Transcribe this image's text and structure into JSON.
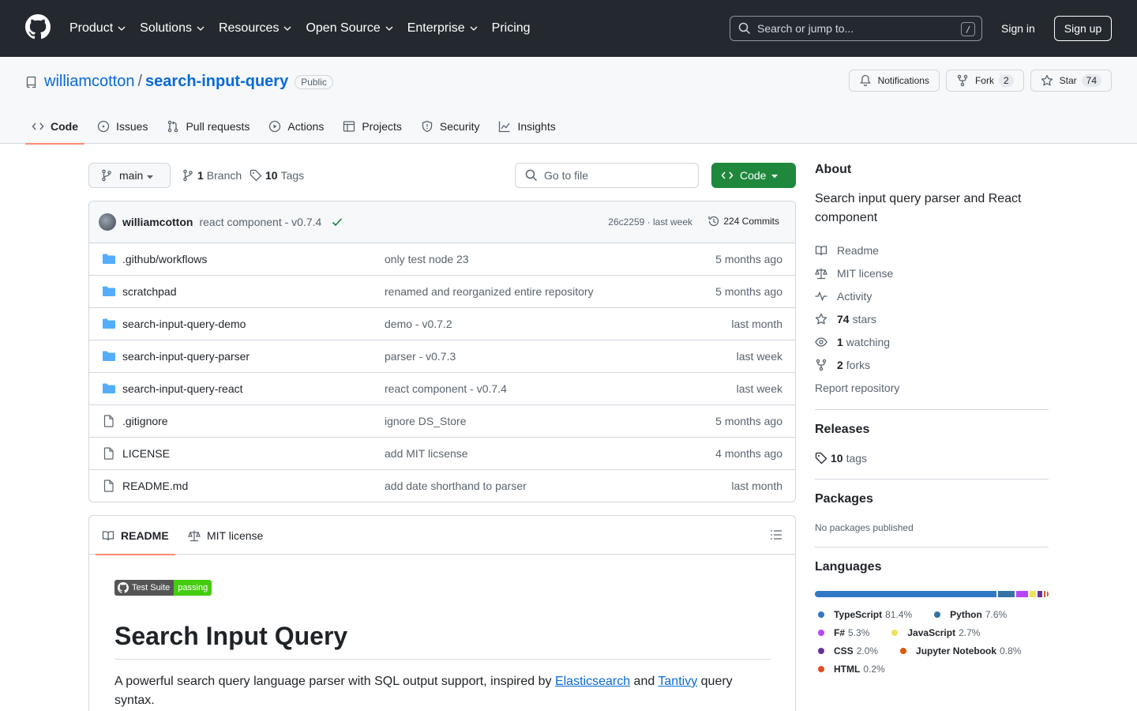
{
  "header": {
    "nav": [
      {
        "label": "Product",
        "dropdown": true
      },
      {
        "label": "Solutions",
        "dropdown": true
      },
      {
        "label": "Resources",
        "dropdown": true
      },
      {
        "label": "Open Source",
        "dropdown": true
      },
      {
        "label": "Enterprise",
        "dropdown": true
      },
      {
        "label": "Pricing",
        "dropdown": false
      }
    ],
    "search_placeholder": "Search or jump to...",
    "search_shortcut": "/",
    "sign_in": "Sign in",
    "sign_up": "Sign up"
  },
  "repo": {
    "owner": "williamcotton",
    "separator": "/",
    "name": "search-input-query",
    "visibility": "Public",
    "notifications_label": "Notifications",
    "fork_label": "Fork",
    "fork_count": "2",
    "star_label": "Star",
    "star_count": "74",
    "tabs": [
      "Code",
      "Issues",
      "Pull requests",
      "Actions",
      "Projects",
      "Security",
      "Insights"
    ]
  },
  "toolbar": {
    "branch": "main",
    "branch_count": "1",
    "branch_label": "Branch",
    "tag_count": "10",
    "tag_label": "Tags",
    "goto_placeholder": "Go to file",
    "code_label": "Code"
  },
  "commit": {
    "author": "williamcotton",
    "message": "react component - v0.7.4",
    "meta": "26c2259 · last week",
    "commits": "224 Commits"
  },
  "files": [
    {
      "type": "dir",
      "name": ".github/workflows",
      "message": "only test node 23",
      "date": "5 months ago"
    },
    {
      "type": "dir",
      "name": "scratchpad",
      "message": "renamed and reorganized entire repository",
      "date": "5 months ago"
    },
    {
      "type": "dir",
      "name": "search-input-query-demo",
      "message": "demo - v0.7.2",
      "date": "last month"
    },
    {
      "type": "dir",
      "name": "search-input-query-parser",
      "message": "parser - v0.7.3",
      "date": "last week"
    },
    {
      "type": "dir",
      "name": "search-input-query-react",
      "message": "react component - v0.7.4",
      "date": "last week"
    },
    {
      "type": "file",
      "name": ".gitignore",
      "message": "ignore DS_Store",
      "date": "5 months ago"
    },
    {
      "type": "file",
      "name": "LICENSE",
      "message": "add MIT licsense",
      "date": "4 months ago"
    },
    {
      "type": "file",
      "name": "README.md",
      "message": "add date shorthand to parser",
      "date": "last month"
    }
  ],
  "readme": {
    "tab_readme": "README",
    "tab_license": "MIT license",
    "badge_left": "Test Suite",
    "badge_right": "passing",
    "title": "Search Input Query",
    "para_before": "A powerful search query language parser with SQL output support, inspired by ",
    "link1": "Elasticsearch",
    "para_mid": " and ",
    "link2": "Tantivy",
    "para_after": " query syntax."
  },
  "sidebar": {
    "about_title": "About",
    "description": "Search input query parser and React component",
    "readme": "Readme",
    "license": "MIT license",
    "activity": "Activity",
    "stars_count": "74",
    "stars_label": "stars",
    "watching_count": "1",
    "watching_label": "watching",
    "forks_count": "2",
    "forks_label": "forks",
    "report": "Report repository",
    "releases_title": "Releases",
    "tags_count": "10",
    "tags_label": "tags",
    "packages_title": "Packages",
    "packages_none": "No packages published",
    "languages_title": "Languages",
    "languages": [
      {
        "name": "TypeScript",
        "pct": "81.4%",
        "value": 81.4,
        "color": "#3178c6"
      },
      {
        "name": "Python",
        "pct": "7.6%",
        "value": 7.6,
        "color": "#3572A5"
      },
      {
        "name": "F#",
        "pct": "5.3%",
        "value": 5.3,
        "color": "#b845fc"
      },
      {
        "name": "JavaScript",
        "pct": "2.7%",
        "value": 2.7,
        "color": "#f1e05a"
      },
      {
        "name": "CSS",
        "pct": "2.0%",
        "value": 2.0,
        "color": "#663399"
      },
      {
        "name": "Jupyter Notebook",
        "pct": "0.8%",
        "value": 0.8,
        "color": "#DA5B0B"
      },
      {
        "name": "HTML",
        "pct": "0.2%",
        "value": 0.2,
        "color": "#e34c26"
      }
    ]
  }
}
